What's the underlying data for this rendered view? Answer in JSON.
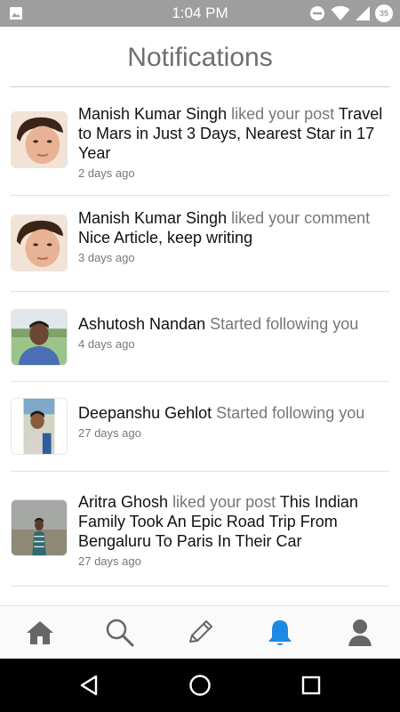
{
  "status_bar": {
    "time": "1:04 PM",
    "battery_level": "35",
    "icons": [
      "image-icon",
      "do-not-disturb-icon",
      "wifi-icon",
      "signal-icon",
      "battery-icon"
    ]
  },
  "header": {
    "title": "Notifications"
  },
  "notifications": [
    {
      "name": "Manish Kumar Singh",
      "action": "liked your post",
      "content": "Travel to Mars in Just 3 Days, Nearest Star in 17 Year",
      "time": "2 days ago"
    },
    {
      "name": "Manish Kumar Singh",
      "action": "liked your comment",
      "content": "Nice Article, keep writing",
      "time": "3 days ago"
    },
    {
      "name": "Ashutosh Nandan",
      "action": "Started following you",
      "content": "",
      "time": "4 days ago"
    },
    {
      "name": "Deepanshu Gehlot",
      "action": "Started following you",
      "content": "",
      "time": "27 days ago"
    },
    {
      "name": "Aritra Ghosh",
      "action": "liked your post",
      "content": "This Indian Family Took An Epic Road Trip From Bengaluru To Paris In Their Car",
      "time": "27 days ago"
    }
  ],
  "bottom_nav": {
    "items": [
      {
        "icon": "home-icon",
        "active": false
      },
      {
        "icon": "search-icon",
        "active": false
      },
      {
        "icon": "pencil-icon",
        "active": false
      },
      {
        "icon": "bell-icon",
        "active": true
      },
      {
        "icon": "profile-icon",
        "active": false
      }
    ],
    "active_color": "#1e88e5",
    "inactive_color": "#666666"
  },
  "system_nav": {
    "icons": [
      "back-icon",
      "home-circle-icon",
      "recents-icon"
    ]
  }
}
